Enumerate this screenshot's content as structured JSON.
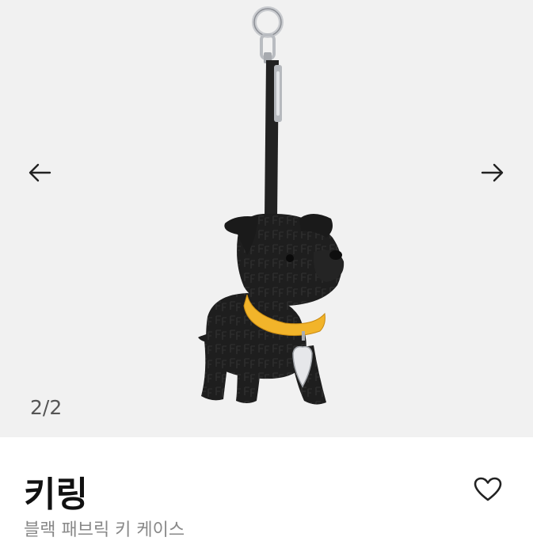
{
  "gallery": {
    "counter": "2/2",
    "prev_icon": "arrow-left-icon",
    "next_icon": "arrow-right-icon"
  },
  "product": {
    "title": "키링",
    "subtitle": "블랙 패브릭 키 케이스",
    "favorite_icon": "heart-outline-icon"
  },
  "colors": {
    "gallery_bg": "#f1f1f1",
    "collar": "#f2b42a",
    "body": "#1c1c1c"
  }
}
